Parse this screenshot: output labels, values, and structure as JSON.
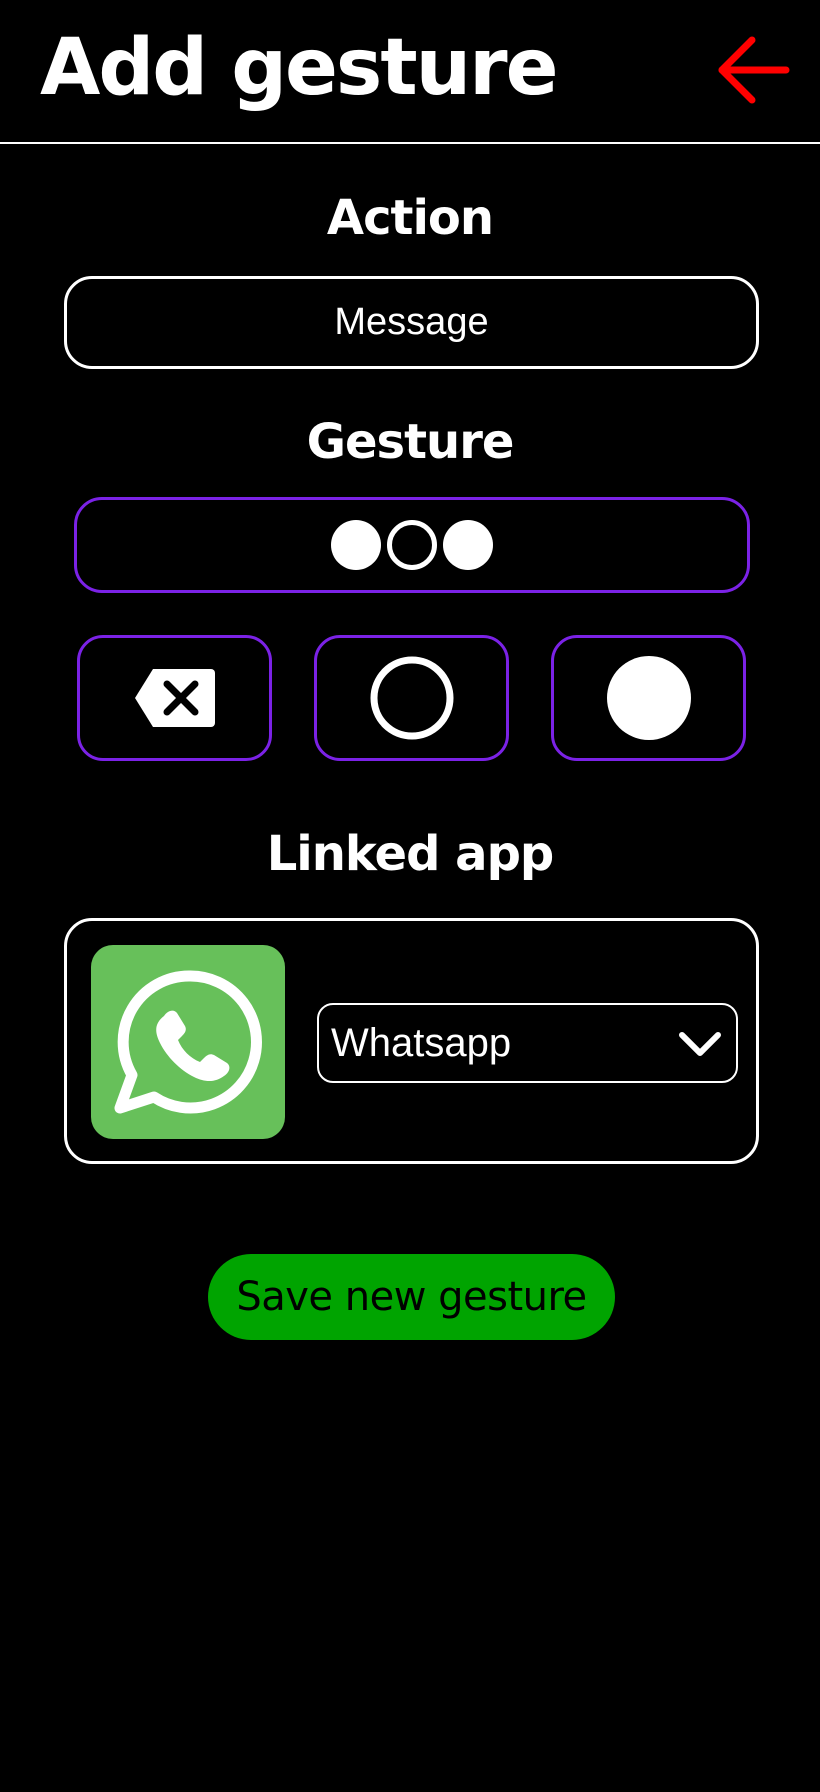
{
  "header": {
    "title": "Add gesture",
    "back_icon": "arrow-left-icon",
    "back_color": "#ff0000"
  },
  "action": {
    "label": "Action",
    "value": "Message"
  },
  "gesture": {
    "label": "Gesture",
    "sequence": [
      "filled",
      "empty",
      "filled"
    ],
    "accent_color": "#7b22e6",
    "keys": [
      {
        "name": "delete",
        "icon": "backspace-icon"
      },
      {
        "name": "empty-dot",
        "icon": "empty-circle-icon"
      },
      {
        "name": "filled-dot",
        "icon": "filled-circle-icon"
      }
    ]
  },
  "linked_app": {
    "label": "Linked app",
    "app_icon": "whatsapp-icon",
    "icon_color": "#67c05a",
    "selected": "Whatsapp",
    "dropdown_icon": "chevron-down-icon"
  },
  "save_button": {
    "label": "Save new gesture",
    "color": "#00a400"
  }
}
